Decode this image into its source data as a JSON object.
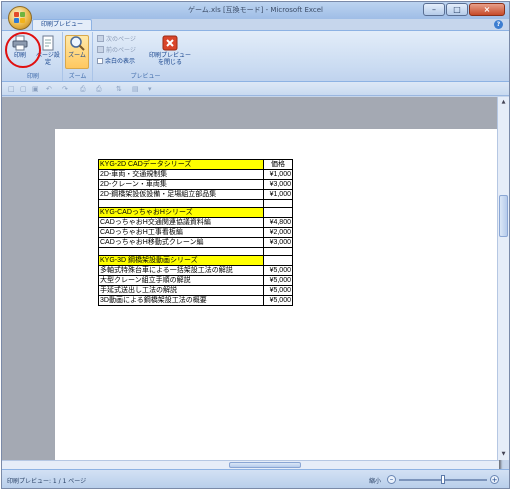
{
  "window": {
    "title": "ゲーム.xls [互換モード] - Microsoft Excel"
  },
  "ribbon": {
    "tab": "印刷プレビュー",
    "groups": [
      {
        "label": "印刷",
        "buttons": [
          "印刷",
          "ページ設定"
        ]
      },
      {
        "label": "ズーム",
        "buttons": [
          "ズーム"
        ]
      },
      {
        "label": "プレビュー",
        "small": [
          "次のページ",
          "前のページ",
          "余白の表示"
        ],
        "close": "印刷プレビューを閉じる"
      }
    ]
  },
  "status": {
    "text": "印刷プレビュー: 1 / 1 ページ",
    "zoom_label": "縮小"
  },
  "sheet": {
    "price_header": "価格",
    "sections": [
      {
        "title": "KYG-2D CADデータシリーズ",
        "rows": [
          {
            "name": "2D-車両・交通規制集",
            "price": "¥1,000"
          },
          {
            "name": "2D-クレーン・車両集",
            "price": "¥3,000"
          },
          {
            "name": "2D-鋼橋架設仮設備・足場組立部品集",
            "price": "¥1,000"
          }
        ]
      },
      {
        "title": "KYG-CADっちゃおHシリーズ",
        "rows": [
          {
            "name": "CADっちゃおH交通関連協議資料編",
            "price": "¥4,800"
          },
          {
            "name": "CADっちゃおH工事看板編",
            "price": "¥2,000"
          },
          {
            "name": "CADっちゃおH移動式クレーン編",
            "price": "¥3,000"
          }
        ]
      },
      {
        "title": "KYG-3D 鋼橋架設動画シリーズ",
        "rows": [
          {
            "name": "多軸式特殊台車による一括架設工法の解説",
            "price": "¥5,000"
          },
          {
            "name": "大型クレーン組立手順の解説",
            "price": "¥5,000"
          },
          {
            "name": "手延式送出し工法の解説",
            "price": "¥5,000"
          },
          {
            "name": "3D動画による鋼橋架設工法の概要",
            "price": "¥5,000"
          }
        ]
      }
    ]
  }
}
